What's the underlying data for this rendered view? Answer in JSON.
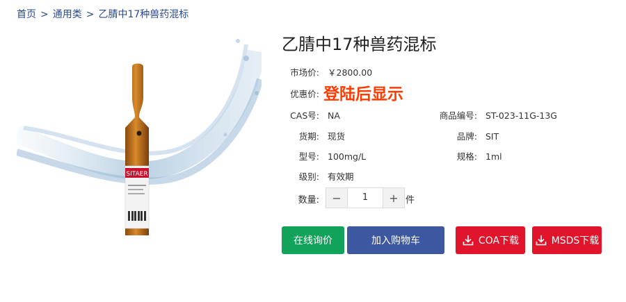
{
  "breadcrumb": {
    "home": "首页",
    "category": "通用类",
    "current": "乙腈中17种兽药混标",
    "separator": ">"
  },
  "product": {
    "title": "乙腈中17种兽药混标",
    "market_price_label": "市场价:",
    "market_price": "￥2800.00",
    "promo_price_label": "优惠价:",
    "promo_price": "登陆后显示",
    "cas_label": "CAS号:",
    "cas": "NA",
    "code_label": "商品编号:",
    "code": "ST-023-11G-13G",
    "stock_label": "货期:",
    "stock": "现货",
    "brand_label": "品牌:",
    "brand": "SIT",
    "model_label": "型号:",
    "model": "100mg/L",
    "spec_label": "规格:",
    "spec": "1ml",
    "grade_label": "级别:",
    "grade": "有效期",
    "image_label": "SITAER"
  },
  "quantity": {
    "label": "数量:",
    "minus": "−",
    "value": "1",
    "plus": "+",
    "unit": "件"
  },
  "buttons": {
    "inquiry": "在线询价",
    "cart": "加入购物车",
    "coa": "COA下载",
    "msds": "MSDS下载"
  },
  "colors": {
    "promo": "#ff3b00",
    "inquiry": "#12a35a",
    "cart": "#3d57a0",
    "download": "#e0142b",
    "breadcrumb": "#2b4a8a"
  }
}
